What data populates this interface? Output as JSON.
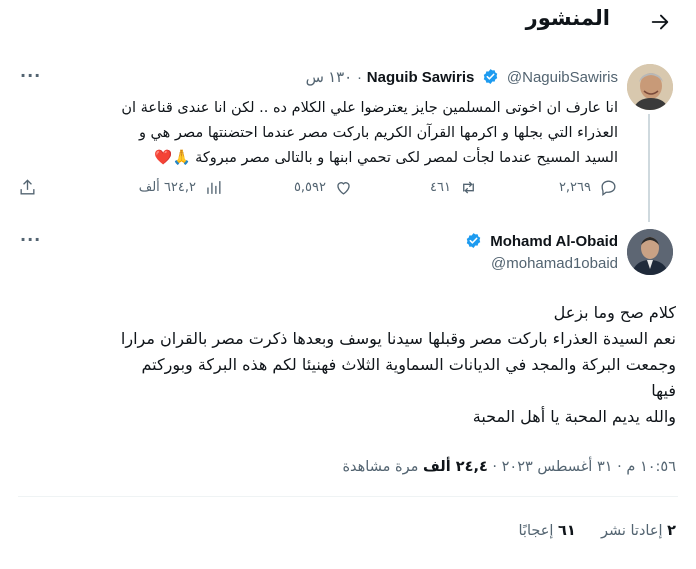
{
  "header": {
    "title": "المنشور",
    "back_icon": "arrow-right-icon"
  },
  "quoted_tweet": {
    "display_name": "Naguib Sawiris",
    "handle": "@NaguibSawiris",
    "time": "١٣٠ س",
    "separator": "·",
    "text_lines": [
      "انا عارف ان اخوتى المسلمين جايز يعترضوا علي الكلام ده .. لكن انا عندى قناعة ان",
      "العذراء التي بجلها و اكرمها القرآن الكريم باركت مصر عندما احتضنتها مصر هي و",
      "السيد المسيح عندما لجأت لمصر لكى تحمي ابنها و بالتالى مصر مبروكة 🙏❤️"
    ],
    "actions": {
      "replies": "٢,٢٦٩",
      "retweets": "٤٦١",
      "likes": "٥,٥٩٢",
      "views": "٦٢٤,٢ ألف"
    }
  },
  "main_tweet": {
    "display_name": "Mohamd Al-Obaid",
    "handle": "@mohamad1obaid",
    "text_lines": [
      "كلام صح وما بزعل",
      "نعم السيدة العذراء باركت مصر وقبلها سيدنا يوسف وبعدها ذكرت مصر بالقران مرارا",
      "وجمعت البركة والمجد في الديانات السماوية الثلاث فهنيئا لكم هذه البركة وبوركتم",
      "فيها",
      "والله يديم المحبة يا أهل المحبة"
    ],
    "timestamp": {
      "time": "١٠:٥٦ م",
      "date": "٣١ أغسطس ٢٠٢٣",
      "views_count": "٢٤,٤ ألف",
      "views_label": "مرة مشاهدة",
      "separator": "·"
    },
    "stats": {
      "reposts_count": "٢",
      "reposts_label": "إعادتا نشر",
      "likes_count": "٦١",
      "likes_label": "إعجابًا"
    }
  },
  "colors": {
    "verified": "#1d9bf0",
    "secondary_text": "#536471",
    "divider": "#eff3f4"
  }
}
